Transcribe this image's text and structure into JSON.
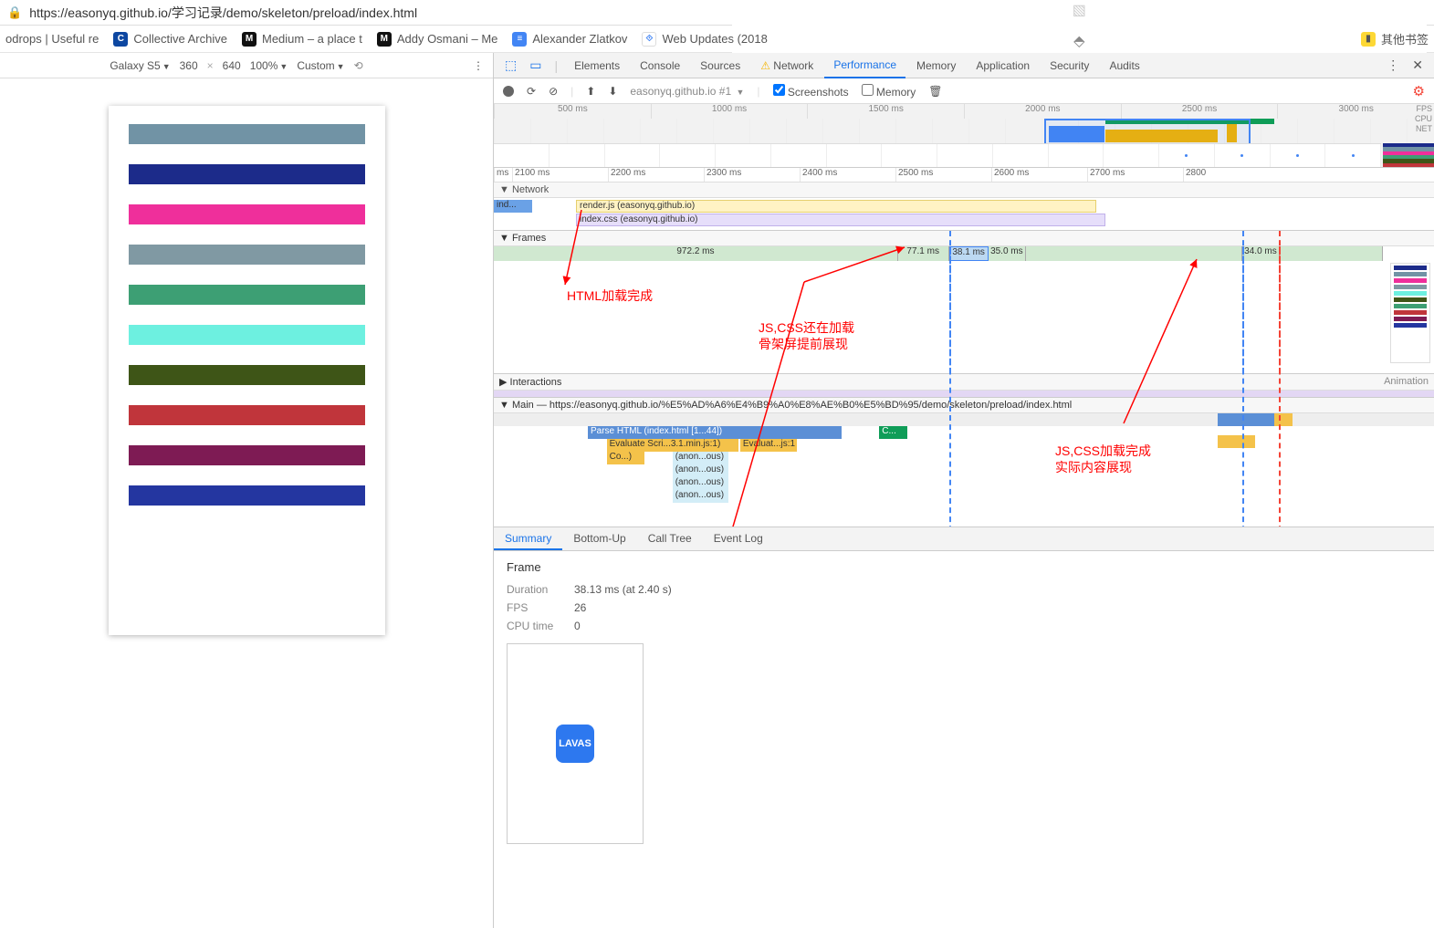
{
  "url": "https://easonyq.github.io/学习记录/demo/skeleton/preload/index.html",
  "bookmarks": {
    "b1": "odrops | Useful re",
    "b2": "Collective Archive",
    "b3": "Medium – a place t",
    "b4": "Addy Osmani – Me",
    "b5": "Alexander Zlatkov",
    "b6": "Web Updates (2018",
    "other": "其他书签"
  },
  "device": {
    "name": "Galaxy S5",
    "w": "360",
    "h": "640",
    "zoom": "100%",
    "throttle": "Custom"
  },
  "skeleton_colors": [
    "#7193a5",
    "#1c2b8a",
    "#ef2f9b",
    "#8099a3",
    "#3d9f74",
    "#6df0e0",
    "#3e5517",
    "#c0353b",
    "#7e1b54",
    "#2436a0"
  ],
  "devtools": {
    "tabs": {
      "elements": "Elements",
      "console": "Console",
      "sources": "Sources",
      "network": "Network",
      "performance": "Performance",
      "memory": "Memory",
      "application": "Application",
      "security": "Security",
      "audits": "Audits"
    },
    "recording_select": "easonyq.github.io #1",
    "chk_screenshots": "Screenshots",
    "chk_memory": "Memory"
  },
  "overview": {
    "ticks": [
      "500 ms",
      "1000 ms",
      "1500 ms",
      "2000 ms",
      "2500 ms",
      "3000 ms"
    ],
    "labels": [
      "FPS",
      "CPU",
      "NET"
    ]
  },
  "ruler2": [
    "ms",
    "2100 ms",
    "2200 ms",
    "2300 ms",
    "2400 ms",
    "2500 ms",
    "2600 ms",
    "2700 ms",
    "2800"
  ],
  "network": {
    "head": "▼ Network",
    "r0": "ind...",
    "r1": "render.js (easonyq.github.io)",
    "r2": "index.css (easonyq.github.io)"
  },
  "frames": {
    "head": "▼ Frames",
    "seg1": "972.2 ms",
    "seg2": "77.1 ms",
    "seg3": "38.1 ms",
    "seg4": "35.0 ms",
    "seg5": "34.0 ms"
  },
  "inter": {
    "head": "▶ Interactions",
    "anim": "Animation"
  },
  "main": {
    "head": "▼ Main — https://easonyq.github.io/%E5%AD%A6%E4%B9%A0%E8%AE%B0%E5%BD%95/demo/skeleton/preload/index.html",
    "t1": "Parse HTML (index.html [1...44])",
    "t2": "Evaluate Scri...3.1.min.js:1)",
    "t3": "Evaluat...js:1",
    "t4": "Co...)",
    "t5": "(anon...ous)",
    "t6": "(anon...ous)",
    "t7": "(anon...ous)",
    "t8": "(anon...ous)",
    "t9": "C..."
  },
  "annots": {
    "a1": "HTML加载完成",
    "a2a": "JS,CSS还在加载",
    "a2b": "骨架屏提前展现",
    "a3a": "JS,CSS加载完成",
    "a3b": "实际内容展现"
  },
  "btabs": {
    "summary": "Summary",
    "bu": "Bottom-Up",
    "ct": "Call Tree",
    "el": "Event Log"
  },
  "summary": {
    "title": "Frame",
    "k1": "Duration",
    "v1": "38.13 ms (at 2.40 s)",
    "k2": "FPS",
    "v2": "26",
    "k3": "CPU time",
    "v3": "0",
    "lavas": "LAVAS"
  }
}
